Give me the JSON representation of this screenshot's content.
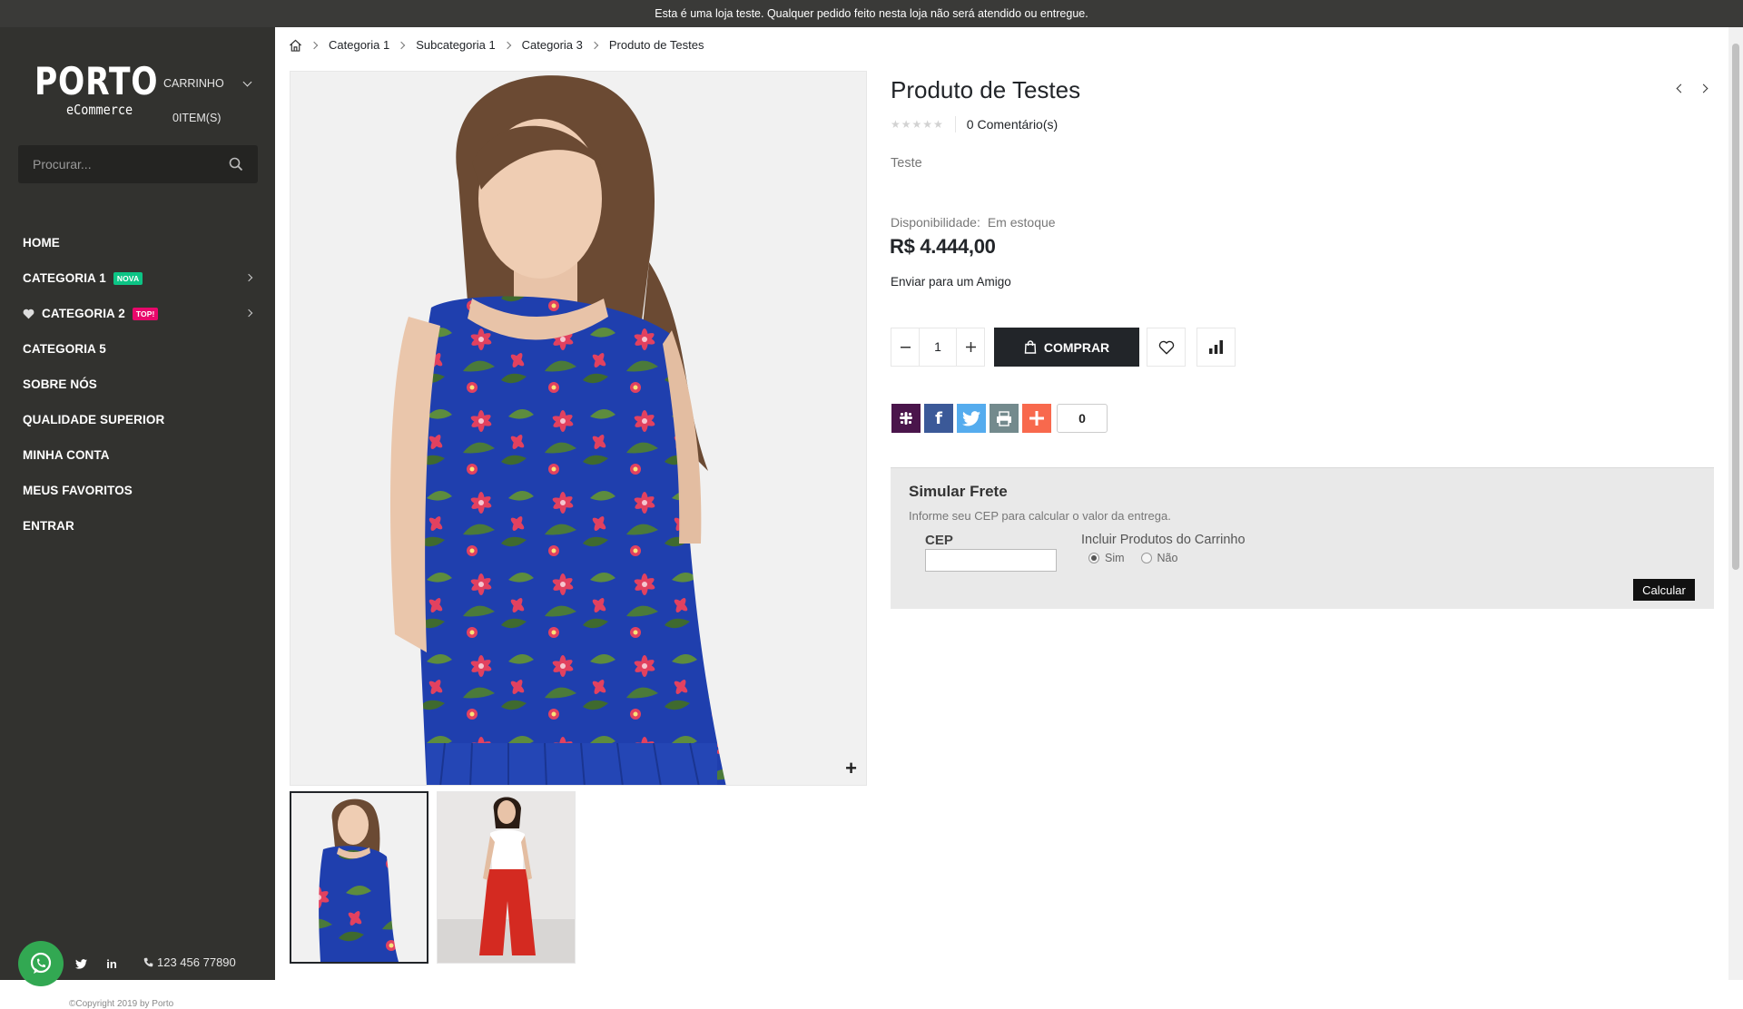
{
  "notice": "Esta é uma loja teste. Qualquer pedido feito nesta loja não será atendido ou entregue.",
  "brand": {
    "name": "PORTO",
    "tagline": "eCommerce"
  },
  "cart": {
    "label": "CARRINHO",
    "items": "0ITEM(S)"
  },
  "search": {
    "placeholder": "Procurar..."
  },
  "nav": [
    {
      "label": "HOME"
    },
    {
      "label": "CATEGORIA 1",
      "tag": "NOVA"
    },
    {
      "label": "CATEGORIA 2",
      "tag": "TOP!"
    },
    {
      "label": "CATEGORIA 5"
    },
    {
      "label": "SOBRE NÓS"
    },
    {
      "label": "QUALIDADE SUPERIOR"
    },
    {
      "label": "MINHA CONTA"
    },
    {
      "label": "MEUS FAVORITOS"
    },
    {
      "label": "ENTRAR"
    }
  ],
  "footer": {
    "phone": "123 456 77890",
    "copyright": "©Copyright 2019 by Porto"
  },
  "breadcrumb": [
    "Categoria 1",
    "Subcategoria 1",
    "Categoria 3",
    "Produto de Testes"
  ],
  "product": {
    "title": "Produto de Testes",
    "reviews": "0 Comentário(s)",
    "rating": 0,
    "short_description": "Teste",
    "availability_label": "Disponibilidade:",
    "availability_value": "Em estoque",
    "price": "R$ 4.444,00",
    "send_friend": "Enviar para um Amigo",
    "quantity": "1",
    "buy_label": "COMPRAR",
    "share_count": "0"
  },
  "frete": {
    "title": "Simular Frete",
    "hint": "Informe seu CEP para calcular o valor da entrega.",
    "cep_label": "CEP",
    "cep_value": "",
    "include_label": "Incluir Produtos do Carrinho",
    "opt_yes": "Sim",
    "opt_no": "Não",
    "selected": "Sim",
    "calc_label": "Calcular"
  },
  "colors": {
    "sidebar": "#32322f",
    "topbar": "#3a3a38",
    "dark": "#222529",
    "tag_new": "#0cc485",
    "tag_top": "#e8086b",
    "whatsapp": "#32a852",
    "slack": "#4a154b",
    "facebook": "#3b5998",
    "twitter": "#55acee",
    "print": "#738a8d",
    "more": "#f8694d"
  }
}
